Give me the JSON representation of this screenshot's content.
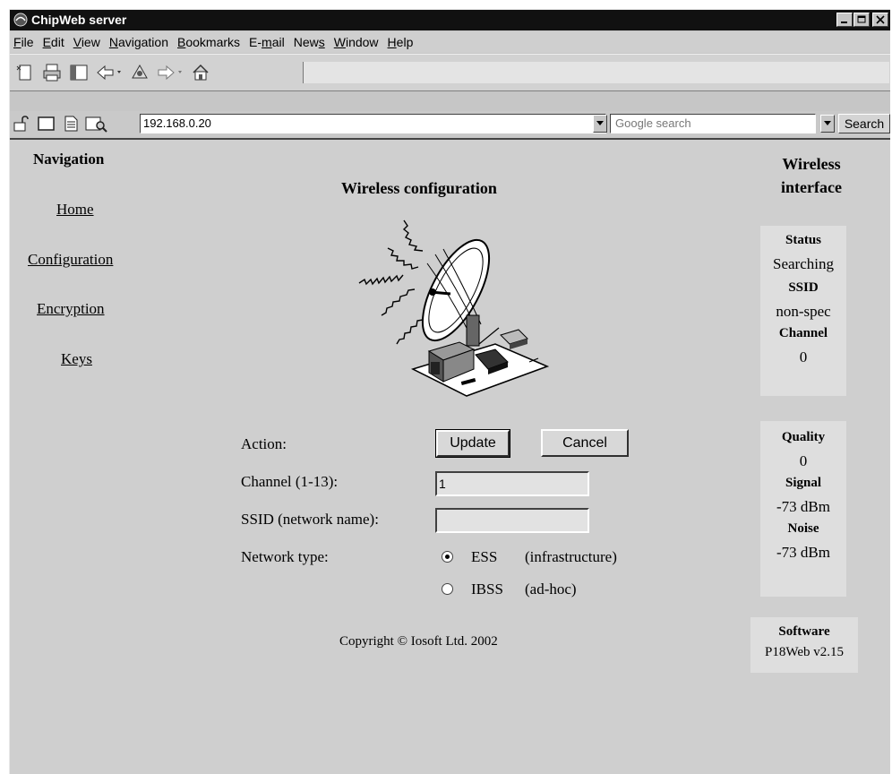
{
  "window": {
    "title": "ChipWeb server"
  },
  "menu": [
    {
      "pre": "",
      "ul": "F",
      "post": "ile"
    },
    {
      "pre": "",
      "ul": "E",
      "post": "dit"
    },
    {
      "pre": "",
      "ul": "V",
      "post": "iew"
    },
    {
      "pre": "",
      "ul": "N",
      "post": "avigation"
    },
    {
      "pre": "",
      "ul": "B",
      "post": "ookmarks"
    },
    {
      "pre": "E-",
      "ul": "m",
      "post": "ail"
    },
    {
      "pre": "New",
      "ul": "s",
      "post": ""
    },
    {
      "pre": "",
      "ul": "W",
      "post": "indow"
    },
    {
      "pre": "",
      "ul": "H",
      "post": "elp"
    }
  ],
  "address": {
    "url": "192.168.0.20"
  },
  "search": {
    "placeholder": "Google search",
    "button": "Search"
  },
  "nav": {
    "heading": "Navigation",
    "links": [
      "Home",
      "Configuration",
      "Encryption",
      "Keys"
    ]
  },
  "page": {
    "title": "Wireless configuration",
    "copyright": "Copyright © Iosoft Ltd. 2002"
  },
  "form": {
    "action_label": "Action:",
    "update_button": "Update",
    "cancel_button": "Cancel",
    "channel_label": "Channel (1-13):",
    "channel_value": "1",
    "ssid_label": "SSID (network name):",
    "ssid_value": "",
    "network_type_label": "Network type:",
    "ess_label": "ESS",
    "ess_desc": "(infrastructure)",
    "ibss_label": "IBSS",
    "ibss_desc": "(ad-hoc)",
    "selected": "ESS"
  },
  "side": {
    "heading_line1": "Wireless",
    "heading_line2": "interface",
    "status_label": "Status",
    "status_value": "Searching",
    "ssid_label": "SSID",
    "ssid_value": "non-spec",
    "channel_label": "Channel",
    "channel_value": "0",
    "quality_label": "Quality",
    "quality_value": "0",
    "signal_label": "Signal",
    "signal_value": "-73 dBm",
    "noise_label": "Noise",
    "noise_value": "-73 dBm",
    "software_label": "Software",
    "software_value": "P18Web v2.15"
  }
}
